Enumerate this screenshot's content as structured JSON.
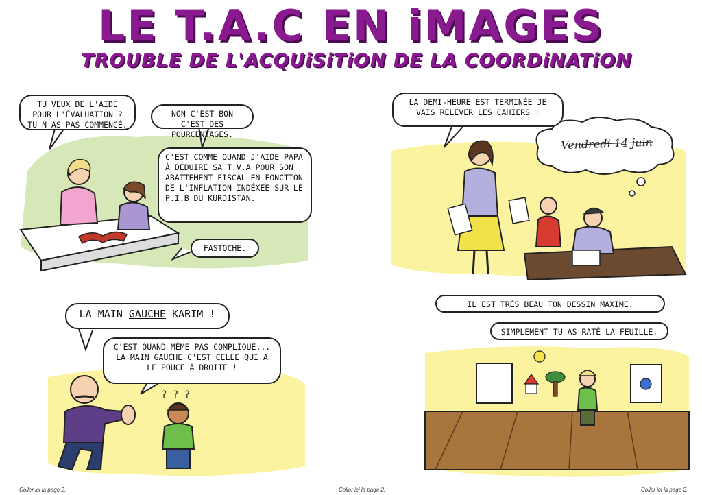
{
  "header": {
    "title": "LE T.A.C EN iMAGES",
    "subtitle": "TROUBLE DE L'ACQUiSiTiON DE LA COORDiNATiON"
  },
  "panels": {
    "p1": {
      "bubble1": "TU VEUX DE L'AIDE POUR L'ÉVALUATION ? TU N'AS PAS COMMENCÉ.",
      "bubble2": "NON C'EST BON C'EST DES POURCENTAGES.",
      "bubble3": "C'EST COMME QUAND J'AIDE PAPA À DÉDUIRE SA T.V.A POUR SON ABATTEMENT FISCAL EN FONCTION DE L'INFLATION INDÉXÉE SUR LE P.I.B DU KURDISTAN.",
      "bubble4": "FASTOCHE."
    },
    "p2": {
      "bubble1": "LA DEMI-HEURE EST TERMINÉE JE VAIS RELEVER LES CAHIERS !",
      "thought": "Vendredi 14 juin"
    },
    "p3": {
      "bubble1_pre": "LA MAIN ",
      "bubble1_u": "GAUCHE",
      "bubble1_post": " KARIM !",
      "bubble2": "C'EST QUAND MÊME PAS COMPLIQUÉ... LA MAIN GAUCHE C'EST CELLE QUI A LE POUCE À DROITE !",
      "confused": "? ? ?"
    },
    "p4": {
      "bubble1": "IL EST TRÈS BEAU TON DESSIN MAXIME.",
      "bubble2": "SIMPLEMENT TU AS RATÉ LA FEUILLE."
    }
  },
  "footer": {
    "left": "Coller ici la page 2.",
    "center": "Coller ici la page 2.",
    "right": "Coller ici la page 2."
  },
  "colors": {
    "title": "#8a1a8f",
    "green_wash": "#d6e8b8",
    "yellow_wash": "#fbf3a0"
  }
}
